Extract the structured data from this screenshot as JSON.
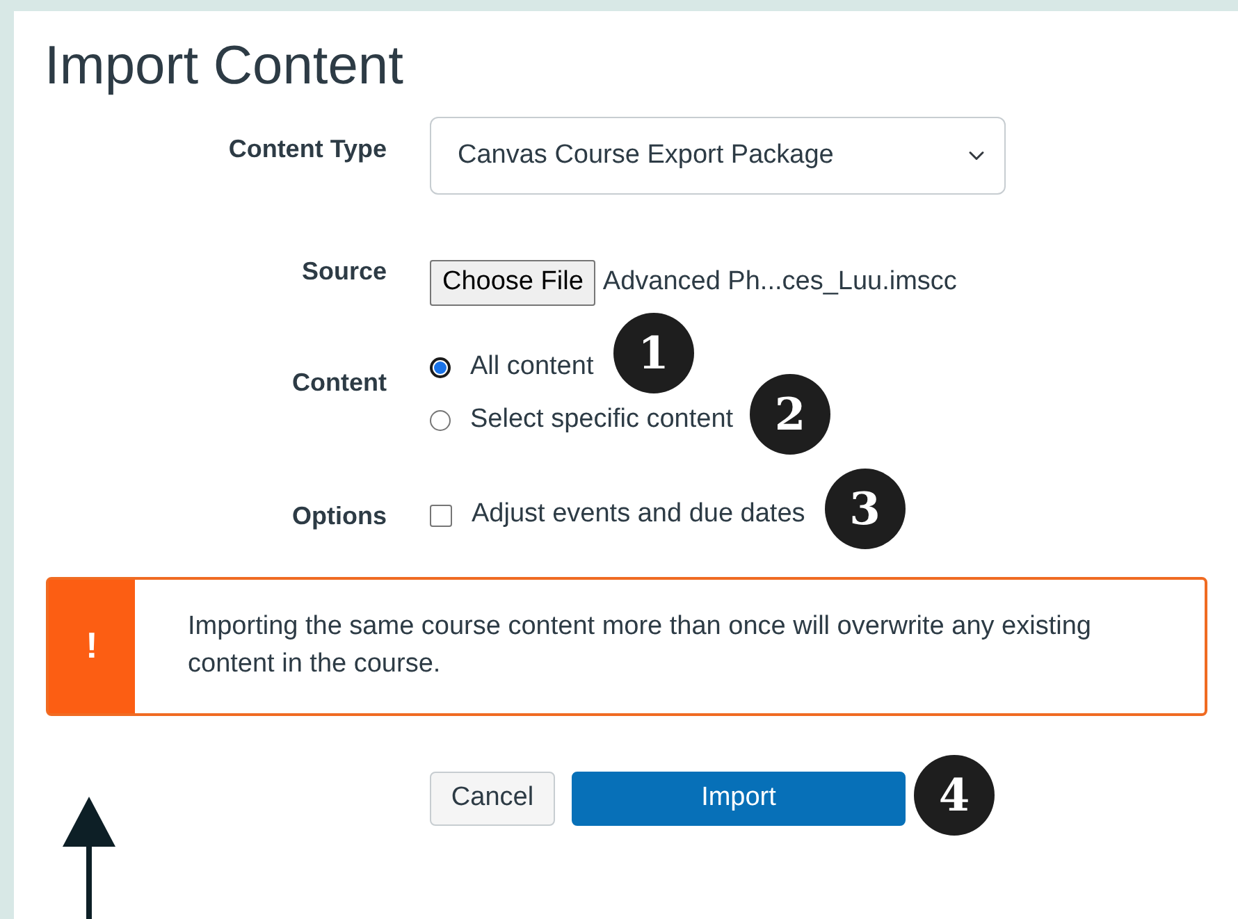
{
  "title": "Import Content",
  "content_type": {
    "label": "Content Type",
    "value": "Canvas Course Export Package"
  },
  "source": {
    "label": "Source",
    "button": "Choose File",
    "file_name": "Advanced Ph...ces_Luu.imscc"
  },
  "content": {
    "label": "Content",
    "options": [
      {
        "label": "All content",
        "selected": true,
        "callout": "1"
      },
      {
        "label": "Select specific content",
        "selected": false,
        "callout": "2"
      }
    ]
  },
  "options": {
    "label": "Options",
    "items": [
      {
        "label": "Adjust events and due dates",
        "checked": false,
        "callout": "3"
      }
    ]
  },
  "alert": {
    "icon": "!",
    "text": "Importing the same course content more than once will overwrite any existing content in the course."
  },
  "buttons": [
    {
      "label": "Cancel",
      "kind": "secondary"
    },
    {
      "label": "Import",
      "kind": "primary",
      "callout": "4"
    }
  ]
}
